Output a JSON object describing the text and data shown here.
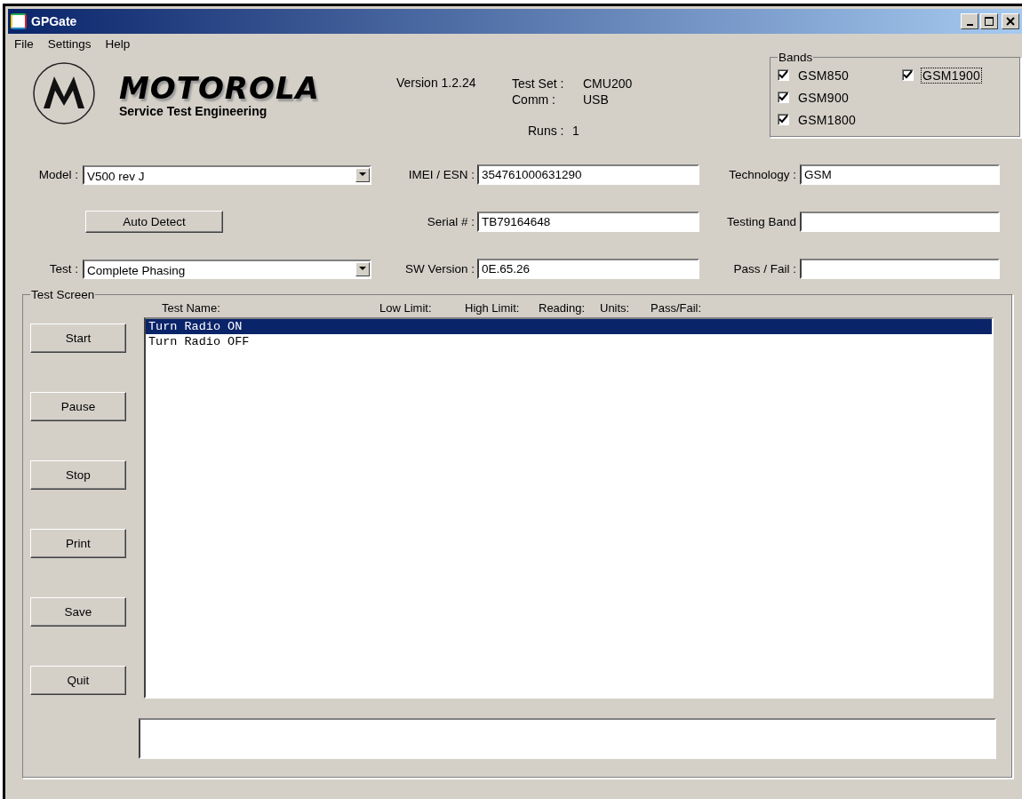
{
  "window": {
    "title": "GPGate"
  },
  "menu": [
    "File",
    "Settings",
    "Help"
  ],
  "logo": {
    "wordmark": "MOTOROLA",
    "subtitle": "Service Test Engineering"
  },
  "version": "Version 1.2.24",
  "info": [
    {
      "label": "Test Set :",
      "value": "CMU200"
    },
    {
      "label": "Comm :",
      "value": "USB"
    }
  ],
  "runs": {
    "label": "Runs :",
    "value": "1"
  },
  "bands": {
    "title": "Bands",
    "items": [
      {
        "label": "GSM850",
        "checked": true,
        "focused": false
      },
      {
        "label": "GSM900",
        "checked": true,
        "focused": false
      },
      {
        "label": "GSM1800",
        "checked": true,
        "focused": false
      },
      {
        "label": "GSM1900",
        "checked": true,
        "focused": true
      }
    ]
  },
  "model": {
    "label": "Model :",
    "value": "V500 rev J"
  },
  "auto_detect": "Auto Detect",
  "test": {
    "label": "Test :",
    "value": "Complete Phasing"
  },
  "device_fields": [
    {
      "label": "IMEI / ESN :",
      "value": "354761000631290"
    },
    {
      "label": "Serial # :",
      "value": "TB79164648"
    },
    {
      "label": "SW Version :",
      "value": "0E.65.26"
    }
  ],
  "status_fields": [
    {
      "label": "Technology :",
      "value": "GSM"
    },
    {
      "label": "Testing Band"
    },
    {
      "label": "Pass / Fail :"
    }
  ],
  "test_screen": {
    "title": "Test Screen",
    "columns": [
      "Test Name:",
      "Low Limit:",
      "High Limit:",
      "Reading:",
      "Units:",
      "Pass/Fail:"
    ],
    "buttons": [
      "Start",
      "Pause",
      "Stop",
      "Print",
      "Save",
      "Quit"
    ],
    "rows": [
      {
        "text": "Turn Radio ON",
        "selected": true
      },
      {
        "text": "Turn Radio OFF",
        "selected": false
      }
    ]
  }
}
